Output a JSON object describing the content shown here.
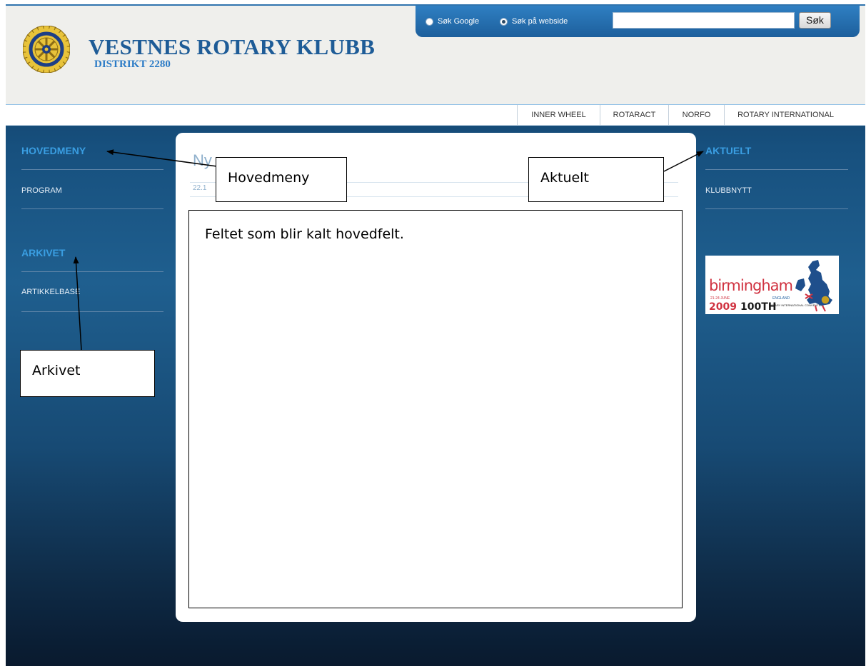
{
  "header": {
    "title": "VESTNES ROTARY KLUBB",
    "subtitle": "DISTRIKT 2280",
    "logo_icon": "rotary-wheel-icon"
  },
  "search": {
    "option_google": "Søk Google",
    "option_site": "Søk på webside",
    "selected": "Søk på webside",
    "input_value": "",
    "button_label": "Søk"
  },
  "nav": {
    "links": [
      "INNER WHEEL",
      "ROTARACT",
      "NORFO",
      "ROTARY INTERNATIONAL"
    ]
  },
  "left_sidebar": {
    "main_heading": "HOVEDMENY",
    "main_items": [
      "PROGRAM"
    ],
    "archive_heading": "ARKIVET",
    "archive_items": [
      "ARTIKKELBASE"
    ]
  },
  "right_sidebar": {
    "heading": "AKTUELT",
    "items": [
      "KLUBBNYTT"
    ]
  },
  "main": {
    "article_title": "Ny",
    "article_date": "22.1",
    "field_label": "Feltet som blir kalt hovedfelt."
  },
  "banner": {
    "word": "birmingham",
    "dates": "21-24 JUNE",
    "place": "ENGLAND",
    "year": "2009",
    "number": "100TH",
    "caption": "ROTARY INTERNATIONAL CONVENTION"
  },
  "annotations": {
    "hovedmeny": "Hovedmeny",
    "aktuelt": "Aktuelt",
    "arkivet": "Arkivet"
  },
  "colors": {
    "accent_blue": "#3a9ee2",
    "title_blue": "#1e5c97",
    "background_navy": "#17507e",
    "banner_red": "#d03240"
  }
}
